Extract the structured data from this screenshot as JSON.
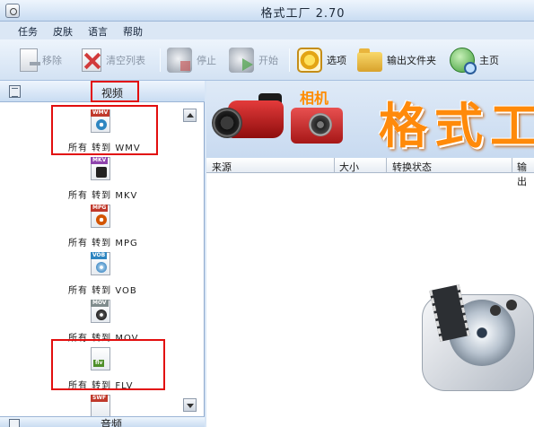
{
  "window": {
    "title": "格式工厂 2.70"
  },
  "menu": [
    "任务",
    "皮肤",
    "语言",
    "帮助"
  ],
  "toolbar": {
    "remove": "移除",
    "clear_list": "清空列表",
    "stop": "停止",
    "start": "开始",
    "options": "选项",
    "output_folder": "输出文件夹",
    "home": "主页"
  },
  "left_panel": {
    "category": "视频",
    "next_category": "音频",
    "items": [
      {
        "tag": "WMV",
        "label": "所有 转到 WMV",
        "color": "#c0392b"
      },
      {
        "tag": "MKV",
        "label": "所有 转到 MKV",
        "color": "#8e44ad"
      },
      {
        "tag": "MPG",
        "label": "所有 转到 MPG",
        "color": "#c0392b"
      },
      {
        "tag": "VOB",
        "label": "所有 转到 VOB",
        "color": "#2e86c1"
      },
      {
        "tag": "MOV",
        "label": "所有 转到 MOV",
        "color": "#7f8c8d"
      },
      {
        "tag": "flv",
        "label": "所有 转到 FLV",
        "color": "#4e8f2a"
      },
      {
        "tag": "SWF",
        "label": "",
        "color": "#c0392b"
      }
    ]
  },
  "banner": {
    "camera_label": "相机",
    "big_title": "格式工"
  },
  "grid": {
    "columns": [
      "来源",
      "大小",
      "转换状态",
      "输出"
    ]
  },
  "colors": {
    "highlight_border": "#e20e0e",
    "banner_title": "#ff8a0a"
  }
}
